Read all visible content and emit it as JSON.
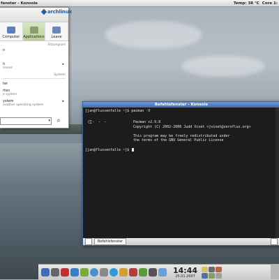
{
  "window_title": "fenster - Konsole",
  "top_panel": {
    "temp": "Temp: 38 °C",
    "core": "Core 1:"
  },
  "menu": {
    "logo": "archlinux",
    "tabs": [
      {
        "label": "Computer",
        "icon": "computer-icon"
      },
      {
        "label": "Applications",
        "icon": "applications-icon"
      },
      {
        "label": "Leave",
        "icon": "leave-icon"
      }
    ],
    "section_sessions": "Sitzungsart",
    "items_a": [
      {
        "label": "n",
        "sub": ""
      },
      {
        "label": "",
        "sub": ""
      },
      {
        "label": "h",
        "sub": ""
      },
      {
        "label": "",
        "sub": "ssions"
      }
    ],
    "section_system": "System",
    "items_b": [
      {
        "label": "ter",
        "sub": ""
      },
      {
        "label": "rten",
        "sub": ""
      },
      {
        "label": "",
        "sub": "e system"
      },
      {
        "label": "ystem",
        "sub": ""
      },
      {
        "label": "",
        "sub": "another operating system"
      }
    ]
  },
  "konsole": {
    "title": "Befehlsfenster - Konsole",
    "prompt1": "[jan@flussenfalle ~]$ pacman -V",
    "version": "Pacman v2.9.8",
    "copyright": "Copyright (C) 2002-2006 Judd Vinet <jvinet@zeroflux.org>",
    "license1": "This program may be freely redistributed under",
    "license2": "the terms of the GNU General Public License",
    "prompt2": "[jan@flussenfalle ~]$ ",
    "tab_label": "Befehlsfenster"
  },
  "clock": {
    "time": "14:44",
    "date": "25.01.2007"
  },
  "colors": {
    "title_bar": "#3f6cb3",
    "tab_active": "#b7cf96",
    "terminal_bg": "#1c1c1c"
  }
}
